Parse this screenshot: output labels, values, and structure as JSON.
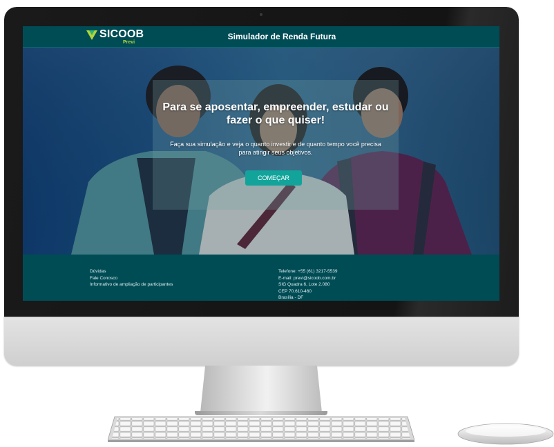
{
  "header": {
    "logo_text": "SICOOB",
    "logo_sub": "Previ",
    "title": "Simulador de Renda Futura"
  },
  "hero": {
    "headline": "Para se aposentar, empreender, estudar ou fazer o que quiser!",
    "subtitle": "Faça sua simulação e veja o quanto investir e de quanto tempo você precisa para atingir seus objetivos.",
    "cta_label": "COMEÇAR"
  },
  "footer": {
    "links": [
      {
        "label": "Dúvidas"
      },
      {
        "label": "Fale Conosco"
      },
      {
        "label": "Informativo de ampliação de participantes"
      }
    ],
    "contact": {
      "phone": "Telefone: +55 (61) 3217-5539",
      "email": "E-mail: previ@sicoob.com.br",
      "address": "SIG Quadra 6, Lote 2.080",
      "cep": "CEP 70.610-460",
      "city": "Brasília - DF"
    }
  },
  "colors": {
    "header_bg": "#004c55",
    "accent": "#12a49b",
    "logo_green": "#b4d43a"
  }
}
